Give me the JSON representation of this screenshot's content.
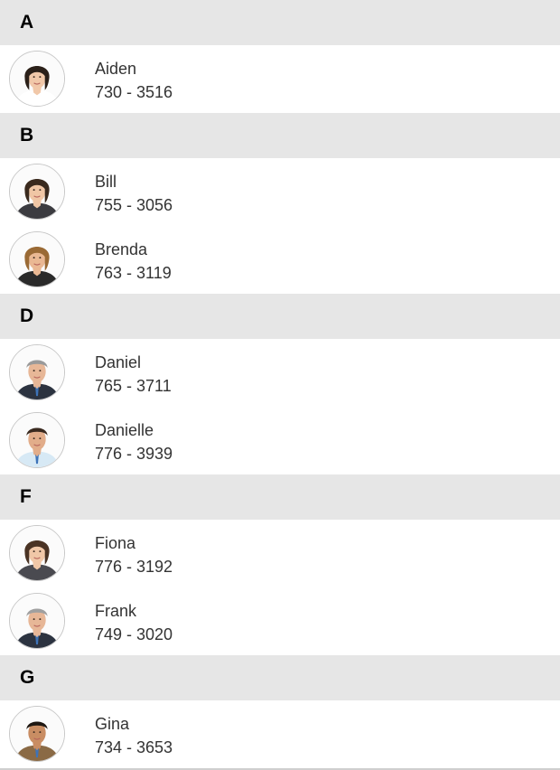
{
  "groups": [
    {
      "letter": "A",
      "contacts": [
        {
          "name": "Aiden",
          "phone": "730 - 3516",
          "avatar": "woman-avatar-icon",
          "skin": "#f1c8a9",
          "hair": "#2b2019",
          "shirt": "#ffffff"
        }
      ]
    },
    {
      "letter": "B",
      "contacts": [
        {
          "name": "Bill",
          "phone": "755 - 3056",
          "avatar": "woman-avatar-icon",
          "skin": "#f0c6a5",
          "hair": "#3a2a1e",
          "shirt": "#3b3b40"
        },
        {
          "name": "Brenda",
          "phone": "763 - 3119",
          "avatar": "woman-avatar-icon",
          "skin": "#eab893",
          "hair": "#9a6a35",
          "shirt": "#2a2a2a"
        }
      ]
    },
    {
      "letter": "D",
      "contacts": [
        {
          "name": "Daniel",
          "phone": "765 - 3711",
          "avatar": "man-avatar-icon",
          "skin": "#e7b797",
          "hair": "#9a9a9a",
          "shirt": "#2c3340"
        },
        {
          "name": "Danielle",
          "phone": "776 - 3939",
          "avatar": "man-avatar-icon",
          "skin": "#e2ad8a",
          "hair": "#3a2a20",
          "shirt": "#d7e9f5"
        }
      ]
    },
    {
      "letter": "F",
      "contacts": [
        {
          "name": "Fiona",
          "phone": "776 - 3192",
          "avatar": "woman-avatar-icon",
          "skin": "#f0c7a7",
          "hair": "#4a3324",
          "shirt": "#4a4a50"
        },
        {
          "name": "Frank",
          "phone": "749 - 3020",
          "avatar": "man-avatar-icon",
          "skin": "#e7b797",
          "hair": "#a0a0a0",
          "shirt": "#2c3340"
        }
      ]
    },
    {
      "letter": "G",
      "contacts": [
        {
          "name": "Gina",
          "phone": "734 - 3653",
          "avatar": "man-avatar-icon",
          "skin": "#c98d63",
          "hair": "#1e1712",
          "shirt": "#8a6a45"
        }
      ]
    }
  ]
}
